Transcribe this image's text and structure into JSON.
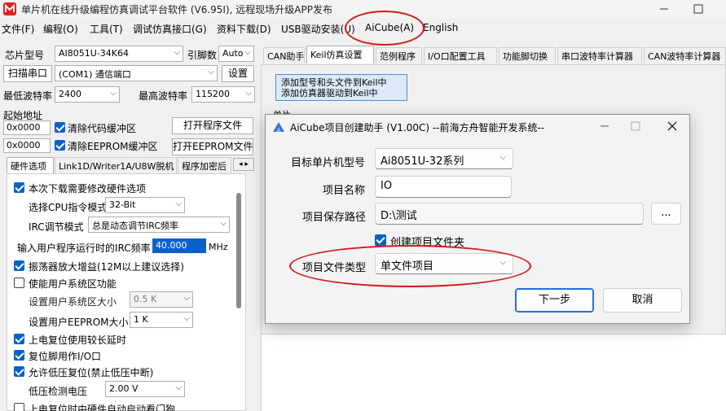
{
  "app": {
    "title": "单片机在线升级编程仿真调试平台软件 (V6.95I), 远程现场升级APP发布"
  },
  "menu": [
    "文件(F)",
    "编程(O)",
    "工具(T)",
    "调试仿真接口(G)",
    "资料下载(D)",
    "USB驱动安装(U)",
    "AiCube(A)",
    "English"
  ],
  "left": {
    "chip_label": "芯片型号",
    "chip_value": "AI8051U-34K64",
    "pin_label": "引脚数",
    "pin_value": "Auto",
    "scan_button": "扫描串口",
    "port_value": "(COM1) 通信端口",
    "settings_button": "设置",
    "min_baud_label": "最低波特率",
    "min_baud_value": "2400",
    "max_baud_label": "最高波特率",
    "max_baud_value": "115200",
    "start_addr_label": "起始地址",
    "addr1": "0x0000",
    "clear_code_label": "清除代码缓冲区",
    "open_program_button": "打开程序文件",
    "addr2": "0x0000",
    "clear_eeprom_label": "清除EEPROM缓冲区",
    "open_eeprom_button": "打开EEPROM文件",
    "tabs": [
      "硬件选项",
      "Link1D/Writer1A/U8W脱机",
      "程序加密后"
    ],
    "options": {
      "modify_hw": "本次下载需要修改硬件选项",
      "cpu_mode_label": "选择CPU指令模式",
      "cpu_mode_value": "32-Bit",
      "irc_mode_label": "IRC调节模式",
      "irc_mode_value": "总是动态调节IRC频率",
      "irc_freq_label": "输入用户程序运行时的IRC频率",
      "irc_freq_value": "40.000",
      "irc_freq_unit": "MHz",
      "osc_gain": "振荡器放大增益(12M以上建议选择)",
      "user_sys_area": "使能用户系统区功能",
      "user_sys_size_label": "设置用户系统区大小",
      "user_sys_size_value": "0.5 K",
      "user_eeprom_label": "设置用户EEPROM大小",
      "user_eeprom_value": "1   K",
      "power_reset_delay": "上电复位使用较长延时",
      "reset_pin_io": "复位脚用作I/O口",
      "low_voltage_reset": "允许低压复位(禁止低压中断)",
      "low_voltage_label": "低压检测电压",
      "low_voltage_value": "2.00 V",
      "hw_watchdog": "上电复位时由硬件自动启动看门狗"
    }
  },
  "right": {
    "tabs": [
      "CAN助手",
      "Keil仿真设置",
      "范例程序",
      "I/O口配置工具",
      "功能脚切换",
      "串口波特率计算器",
      "CAN波特率计算器"
    ],
    "keil_button_line1": "添加型号和头文件到Keil中",
    "keil_button_line2": "添加仿真器驱动到Keil中",
    "unit_label": "单片"
  },
  "dialog": {
    "title": "AiCube项目创建助手 (V1.00C) --前海方舟智能开发系统--",
    "target_mcu_label": "目标单片机型号",
    "target_mcu_value": "Ai8051U-32系列",
    "project_name_label": "项目名称",
    "project_name_value": "IO",
    "save_path_label": "项目保存路径",
    "save_path_value": "D:\\测试",
    "browse_button": "...",
    "create_folder_label": "创建项目文件夹",
    "file_type_label": "项目文件类型",
    "file_type_value": "单文件项目",
    "next_button": "下一步",
    "cancel_button": "取消"
  },
  "colors": {
    "accent": "#0a62c9",
    "annotation": "#d41b1b"
  }
}
